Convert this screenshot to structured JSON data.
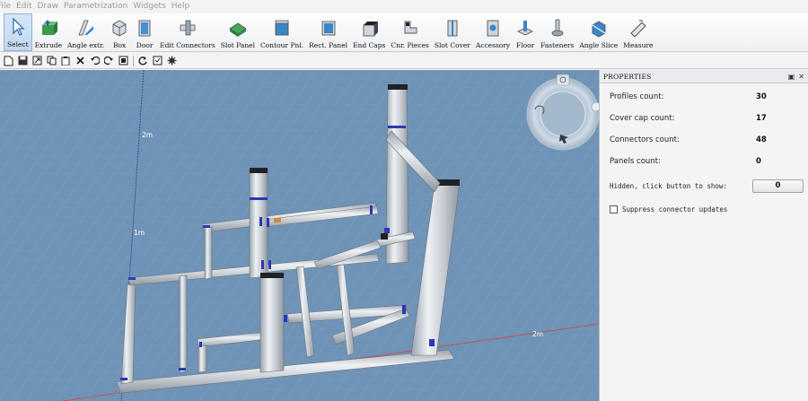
{
  "menu": [
    "File",
    "Edit",
    "Draw",
    "Parametrization",
    "Widgets",
    "Help"
  ],
  "ribbon": {
    "active": "Select",
    "tools": [
      {
        "label": "Select",
        "icon": "cursor-icon"
      },
      {
        "label": "Extrude",
        "icon": "extrude-icon"
      },
      {
        "label": "Angle extr.",
        "icon": "angle-extrude-icon"
      },
      {
        "label": "Box",
        "icon": "box-icon"
      },
      {
        "label": "Door",
        "icon": "door-icon"
      },
      {
        "label": "Edit Connectors",
        "icon": "connectors-icon"
      },
      {
        "label": "Slot Panel",
        "icon": "slot-panel-icon"
      },
      {
        "label": "Contour Pnl.",
        "icon": "contour-panel-icon"
      },
      {
        "label": "Rect. Panel",
        "icon": "rect-panel-icon"
      },
      {
        "label": "End Caps",
        "icon": "end-caps-icon"
      },
      {
        "label": "Cnr. Pieces",
        "icon": "corner-pieces-icon"
      },
      {
        "label": "Slot Cover",
        "icon": "slot-cover-icon"
      },
      {
        "label": "Accessory",
        "icon": "accessory-icon"
      },
      {
        "label": "Floor",
        "icon": "floor-icon"
      },
      {
        "label": "Fasteners",
        "icon": "fasteners-icon"
      },
      {
        "label": "Angle Slice",
        "icon": "angle-slice-icon"
      },
      {
        "label": "Measure",
        "icon": "measure-icon"
      }
    ]
  },
  "viewport": {
    "labels": {
      "vertical_2m": "2m",
      "vertical_1m": "1m",
      "horizontal_2m": "2m"
    }
  },
  "properties": {
    "title": "PROPERTIES",
    "rows": [
      {
        "label": "Profiles count:",
        "value": "30"
      },
      {
        "label": "Cover cap count:",
        "value": "17"
      },
      {
        "label": "Connectors count:",
        "value": "48"
      },
      {
        "label": "Panels count:",
        "value": "0"
      }
    ],
    "hidden_label": "Hidden, click button to show:",
    "hidden_button": "0",
    "suppress_label": "Suppress connector updates",
    "suppress_checked": false
  }
}
